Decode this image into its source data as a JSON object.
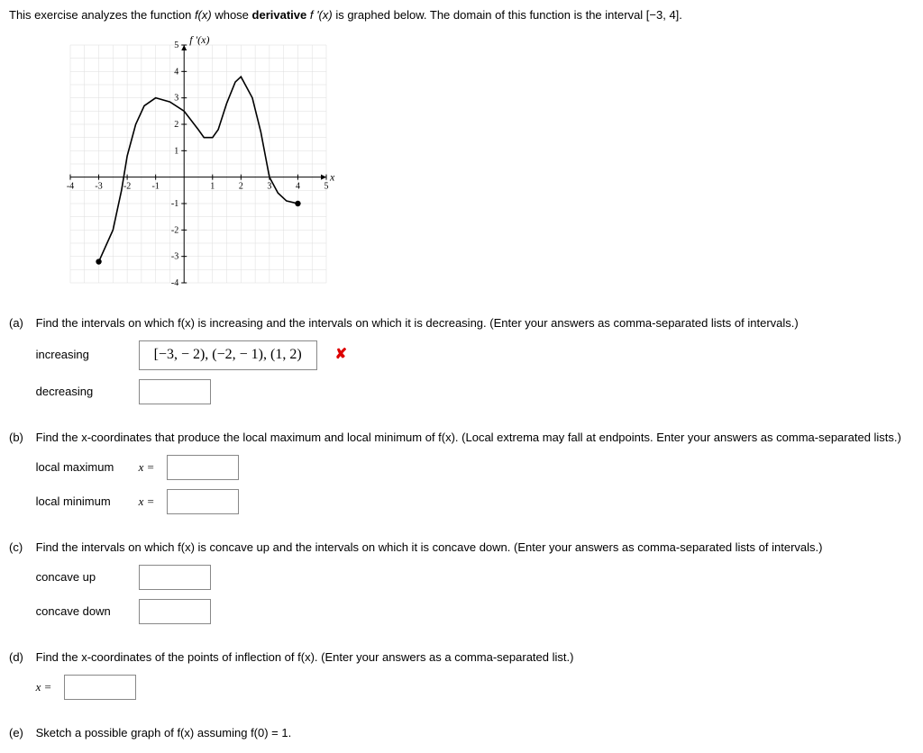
{
  "intro": {
    "pre": "This exercise analyzes the function ",
    "fx": "f(x)",
    "mid": " whose ",
    "bold": "derivative",
    "fpx": " f '(x)",
    "post": " is graphed below. The domain of this function is the interval [−3, 4]."
  },
  "graph": {
    "ylabel": "f '(x)",
    "xlabel": "x",
    "xmin": -4,
    "xmax": 5,
    "ymin": -4,
    "ymax": 5,
    "xticks": [
      -4,
      -3,
      -2,
      -1,
      1,
      2,
      3,
      4,
      5
    ],
    "yticks": [
      -4,
      -3,
      -2,
      -1,
      1,
      2,
      3,
      4,
      5
    ]
  },
  "chart_data": {
    "type": "line",
    "title": "f '(x)",
    "xlabel": "x",
    "ylabel": "f '(x)",
    "xlim": [
      -4,
      5
    ],
    "ylim": [
      -4,
      5
    ],
    "series": [
      {
        "name": "f'(x)",
        "x": [
          -3,
          -2.5,
          -2.2,
          -2,
          -1.7,
          -1.4,
          -1,
          -0.5,
          0,
          0.5,
          0.7,
          1,
          1.2,
          1.5,
          1.8,
          2,
          2.4,
          2.7,
          3,
          3.3,
          3.6,
          4
        ],
        "values": [
          -3.2,
          -2.0,
          -0.5,
          0.8,
          2.0,
          2.7,
          3.0,
          2.85,
          2.5,
          1.8,
          1.5,
          1.5,
          1.8,
          2.8,
          3.6,
          3.8,
          3.0,
          1.7,
          0,
          -0.6,
          -0.9,
          -1.0
        ]
      }
    ],
    "endpoints": [
      {
        "x": -3,
        "y": -3.2
      },
      {
        "x": 4,
        "y": -1.0
      }
    ]
  },
  "parts": {
    "a": {
      "label": "(a)",
      "prompt": "Find the intervals on which f(x) is increasing and the intervals on which it is decreasing. (Enter your answers as comma-separated lists of intervals.)",
      "increasing_label": "increasing",
      "increasing_answer": "[−3, − 2), (−2, − 1), (1, 2)",
      "decreasing_label": "decreasing",
      "decreasing_answer": ""
    },
    "b": {
      "label": "(b)",
      "prompt": "Find the x-coordinates that produce the local maximum and local minimum of f(x). (Local extrema may fall at endpoints. Enter your answers as comma-separated lists.)",
      "max_label": "local maximum",
      "min_label": "local minimum",
      "eq": "x ="
    },
    "c": {
      "label": "(c)",
      "prompt": "Find the intervals on which f(x) is concave up and the intervals on which it is concave down. (Enter your answers as comma-separated lists of intervals.)",
      "up_label": "concave up",
      "down_label": "concave down"
    },
    "d": {
      "label": "(d)",
      "prompt": "Find the x-coordinates of the points of inflection of f(x). (Enter your answers as a comma-separated list.)",
      "eq": "x ="
    },
    "e": {
      "label": "(e)",
      "prompt": "Sketch a possible graph of f(x) assuming f(0) = 1."
    }
  },
  "wrong_mark": "✘"
}
